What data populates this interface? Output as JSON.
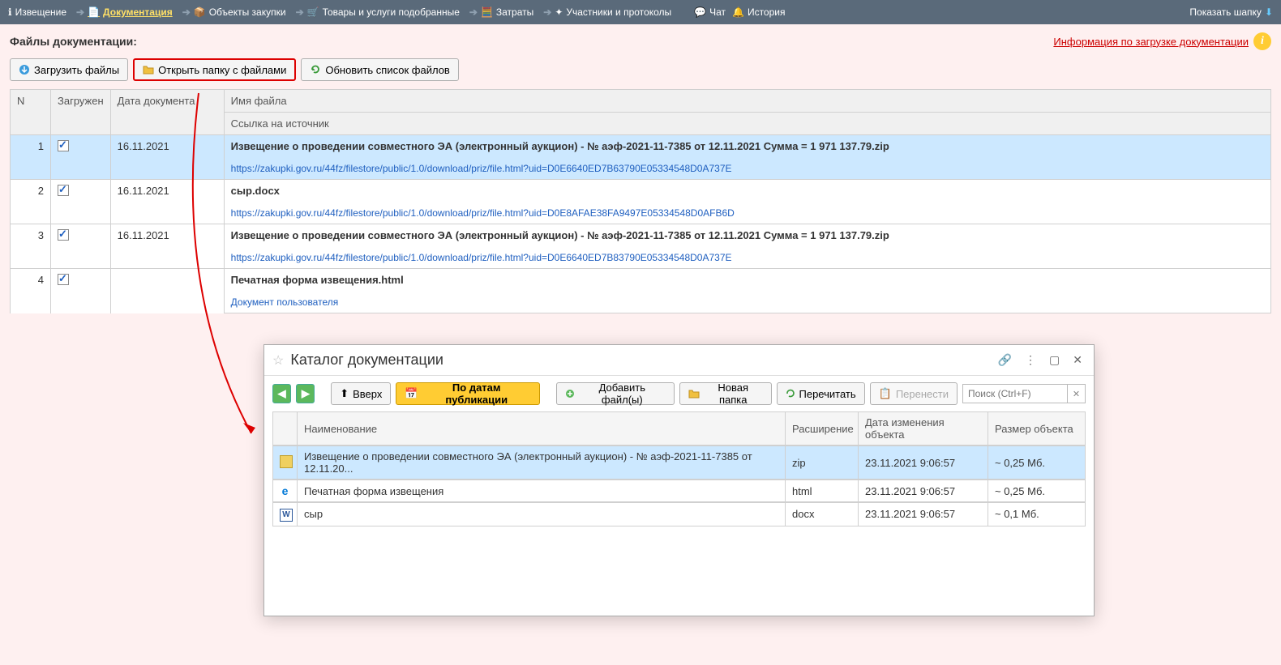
{
  "topnav": {
    "items": [
      {
        "label": "Извещение"
      },
      {
        "label": "Документация",
        "active": true
      },
      {
        "label": "Объекты закупки"
      },
      {
        "label": "Товары и услуги подобранные"
      },
      {
        "label": "Затраты"
      },
      {
        "label": "Участники и протоколы"
      },
      {
        "label": "Чат"
      },
      {
        "label": "История"
      }
    ],
    "show_header": "Показать шапку"
  },
  "section": {
    "title": "Файлы документации:",
    "info_link": "Информация по загрузке документации"
  },
  "actions": {
    "upload": "Загрузить файлы",
    "open_folder": "Открыть папку с файлами",
    "refresh": "Обновить список файлов"
  },
  "table": {
    "headers": {
      "n": "N",
      "loaded": "Загружен",
      "date": "Дата документа",
      "filename": "Имя файла",
      "source": "Ссылка на источник"
    },
    "rows": [
      {
        "n": "1",
        "checked": true,
        "date": "16.11.2021",
        "name": "Извещение о проведении совместного ЭА (электронный аукцион) - № аэф-2021-11-7385 от 12.11.2021 Сумма = 1 971 137.79.zip",
        "link": "https://zakupki.gov.ru/44fz/filestore/public/1.0/download/priz/file.html?uid=D0E6640ED7B63790E05334548D0A737E",
        "selected": true
      },
      {
        "n": "2",
        "checked": true,
        "date": "16.11.2021",
        "name": "сыр.docx",
        "link": "https://zakupki.gov.ru/44fz/filestore/public/1.0/download/priz/file.html?uid=D0E8AFAE38FA9497E05334548D0AFB6D"
      },
      {
        "n": "3",
        "checked": true,
        "date": "16.11.2021",
        "name": "Извещение о проведении совместного ЭА (электронный аукцион) - № аэф-2021-11-7385 от 12.11.2021 Сумма = 1 971 137.79.zip",
        "link": "https://zakupki.gov.ru/44fz/filestore/public/1.0/download/priz/file.html?uid=D0E6640ED7B83790E05334548D0A737E"
      },
      {
        "n": "4",
        "checked": true,
        "date": "",
        "name": "Печатная форма извещения.html",
        "link": "Документ пользователя"
      }
    ]
  },
  "catalog": {
    "title": "Каталог документации",
    "toolbar": {
      "up": "Вверх",
      "by_dates": "По датам публикации",
      "add_files": "Добавить файл(ы)",
      "new_folder": "Новая папка",
      "reread": "Перечитать",
      "move": "Перенести"
    },
    "search_placeholder": "Поиск (Ctrl+F)",
    "headers": {
      "name": "Наименование",
      "ext": "Расширение",
      "modified": "Дата изменения объекта",
      "size": "Размер объекта"
    },
    "rows": [
      {
        "ico": "zip",
        "name": "Извещение о проведении совместного ЭА (электронный аукцион) - № аэф-2021-11-7385 от 12.11.20...",
        "ext": "zip",
        "modified": "23.11.2021 9:06:57",
        "size": "~ 0,25 Мб.",
        "selected": true
      },
      {
        "ico": "html",
        "name": "Печатная форма извещения",
        "ext": "html",
        "modified": "23.11.2021 9:06:57",
        "size": "~ 0,25 Мб."
      },
      {
        "ico": "docx",
        "name": "сыр",
        "ext": "docx",
        "modified": "23.11.2021 9:06:57",
        "size": "~ 0,1 Мб."
      }
    ]
  }
}
